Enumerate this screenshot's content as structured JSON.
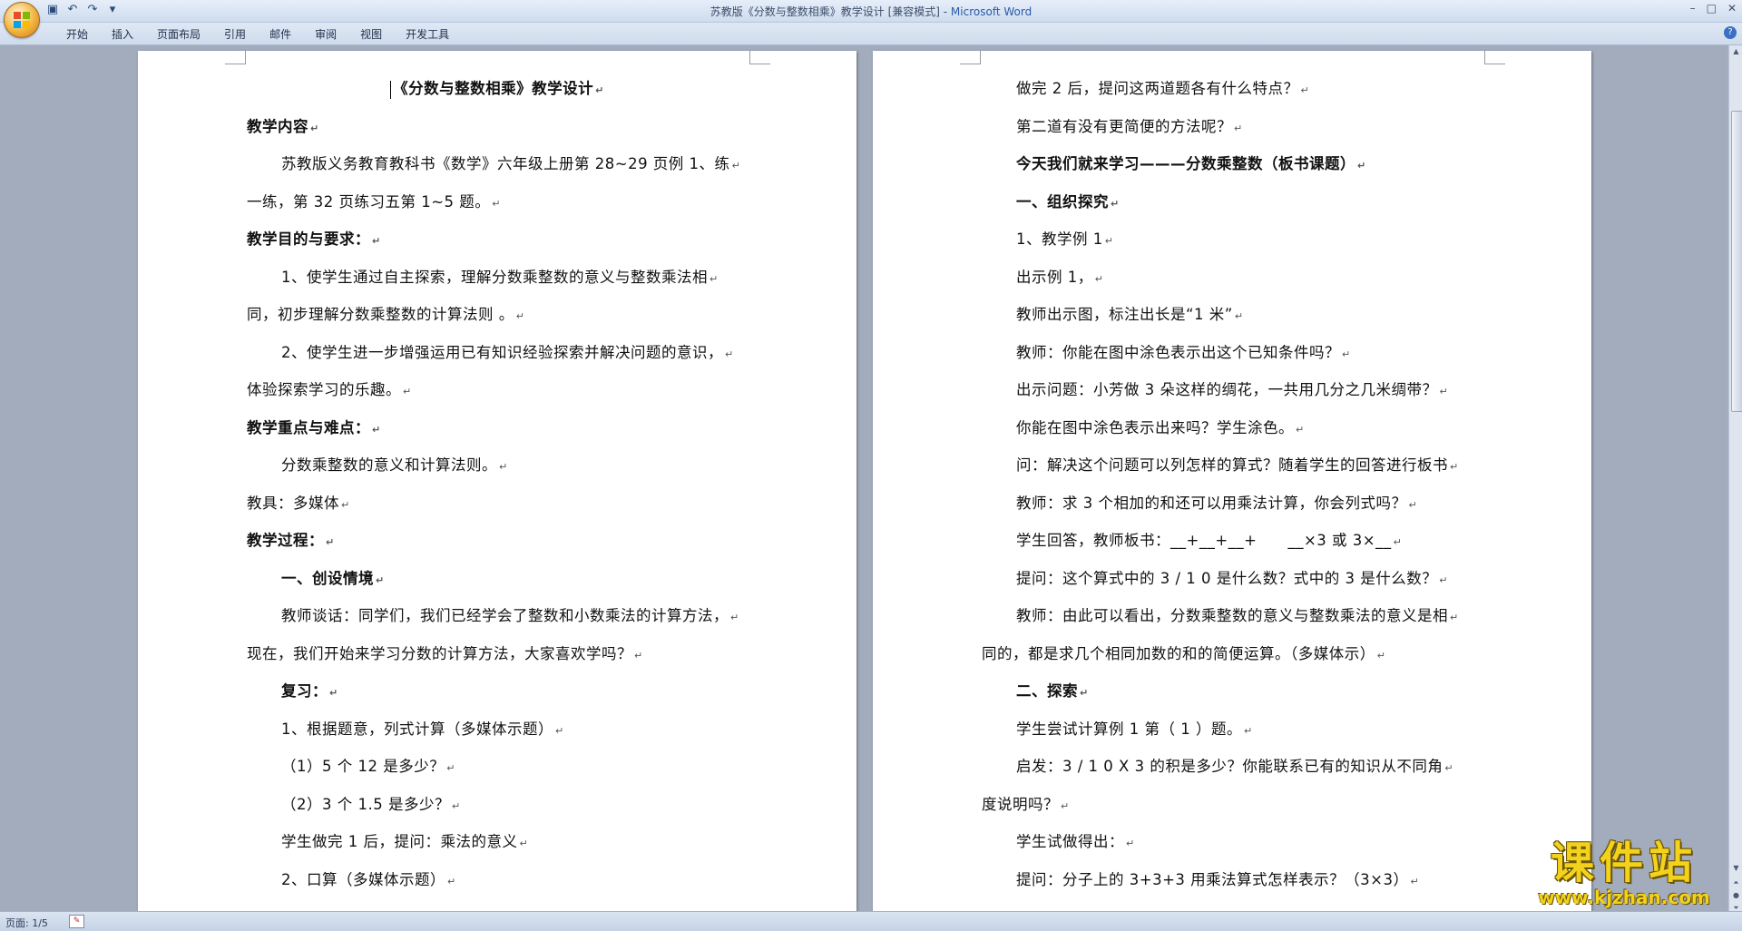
{
  "window": {
    "title": "苏教版《分数与整数相乘》教学设计 [兼容模式] - ",
    "app_name": "Microsoft Word",
    "minimize": "–",
    "maximize": "□",
    "close": "✕"
  },
  "qat": {
    "save_icon": "save-icon",
    "undo_icon": "undo-icon",
    "redo_icon": "redo-icon"
  },
  "menu": [
    "开始",
    "插入",
    "页面布局",
    "引用",
    "邮件",
    "审阅",
    "视图",
    "开发工具"
  ],
  "help": "?",
  "page1": [
    {
      "text": "《分数与整数相乘》教学设计",
      "bold": true
    },
    {
      "text": "教学内容",
      "bold": true
    },
    {
      "text": "苏教版义务教育教科书《数学》六年级上册第 28~29 页例 1、练",
      "bold": false
    },
    {
      "text": "一练，第 32 页练习五第 1~5 题。",
      "bold": false
    },
    {
      "text": "教学目的与要求：",
      "bold": true
    },
    {
      "text": "1、使学生通过自主探索，理解分数乘整数的意义与整数乘法相",
      "bold": false
    },
    {
      "text": "同，初步理解分数乘整数的计算法则 。",
      "bold": false
    },
    {
      "text": "2、使学生进一步增强运用已有知识经验探索并解决问题的意识，",
      "bold": false
    },
    {
      "text": "体验探索学习的乐趣。",
      "bold": false
    },
    {
      "text": "教学重点与难点：",
      "bold": true
    },
    {
      "text": "分数乘整数的意义和计算法则。",
      "bold": false
    },
    {
      "text": "教具：多媒体",
      "bold": false
    },
    {
      "text": "教学过程：",
      "bold": true
    },
    {
      "text": "一、创设情境",
      "bold": true
    },
    {
      "text": "教师谈话：同学们，我们已经学会了整数和小数乘法的计算方法，",
      "bold": false
    },
    {
      "text": "现在，我们开始来学习分数的计算方法，大家喜欢学吗？",
      "bold": false
    },
    {
      "text": "复习：",
      "bold": true
    },
    {
      "text": "1、根据题意，列式计算（多媒体示题）",
      "bold": false
    },
    {
      "text": "（1）5 个 12 是多少？",
      "bold": false
    },
    {
      "text": "（2）3 个 1.5 是多少？",
      "bold": false
    },
    {
      "text": "学生做完 1 后，提问：乘法的意义",
      "bold": false
    },
    {
      "text": "2、口算（多媒体示题）",
      "bold": false
    }
  ],
  "page2": [
    {
      "text": "做完 2 后，提问这两道题各有什么特点？",
      "bold": false
    },
    {
      "text": "第二道有没有更简便的方法呢？",
      "bold": false
    },
    {
      "text": "今天我们就来学习———分数乘整数（板书课题）",
      "bold": true
    },
    {
      "text": "一、组织探究",
      "bold": true
    },
    {
      "text": "1、教学例 1",
      "bold": false
    },
    {
      "text": "出示例 1，",
      "bold": false
    },
    {
      "text": "教师出示图，标注出长是“1 米”",
      "bold": false
    },
    {
      "text": "教师：你能在图中涂色表示出这个已知条件吗？",
      "bold": false
    },
    {
      "text": "出示问题：小芳做 3 朵这样的绸花，一共用几分之几米绸带？",
      "bold": false
    },
    {
      "text": "你能在图中涂色表示出来吗？学生涂色。",
      "bold": false
    },
    {
      "text": "问：解决这个问题可以列怎样的算式？随着学生的回答进行板书",
      "bold": false
    },
    {
      "text": "教师：求 3 个相加的和还可以用乘法计算，你会列式吗？",
      "bold": false
    },
    {
      "text": "学生回答，教师板书：__+__+__+　　__×3 或 3×__",
      "bold": false
    },
    {
      "text": "提问：这个算式中的 3 / 1 0 是什么数？式中的 3 是什么数？",
      "bold": false
    },
    {
      "text": "教师：由此可以看出，分数乘整数的意义与整数乘法的意义是相",
      "bold": false
    },
    {
      "text": "同的，都是求几个相同加数的和的简便运算。（多媒体示）",
      "bold": false
    },
    {
      "text": "二、探索",
      "bold": true
    },
    {
      "text": "学生尝试计算例 1 第（ 1 ）题。",
      "bold": false
    },
    {
      "text": "启发：3 / 1 0 X 3 的积是多少？你能联系已有的知识从不同角",
      "bold": false
    },
    {
      "text": "度说明吗？",
      "bold": false
    },
    {
      "text": "学生试做得出：",
      "bold": false
    },
    {
      "text": "提问：分子上的 3+3+3 用乘法算式怎样表示？（3×3）",
      "bold": false
    }
  ],
  "status": {
    "page": "页面: 1/5"
  },
  "watermark": {
    "title": "课件站",
    "url": "www.kjzhan.com"
  }
}
